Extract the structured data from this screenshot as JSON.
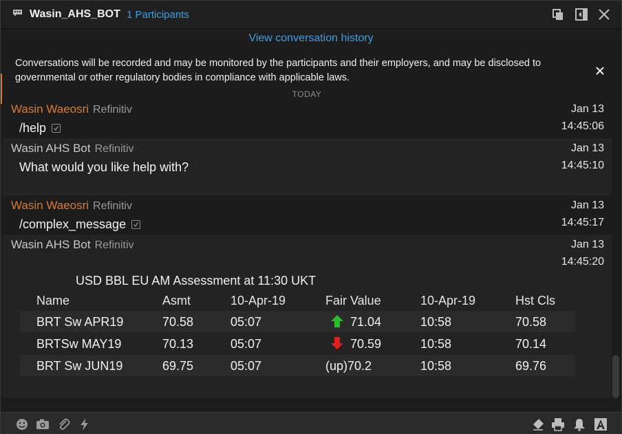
{
  "window": {
    "title": "Wasin_AHS_BOT",
    "participants": "1 Participants"
  },
  "history_link": "View conversation history",
  "notice": {
    "text": "Conversations will be recorded and may be monitored by the participants and their employers, and may be disclosed to governmental or other regulatory bodies in compliance with applicable laws."
  },
  "day_separator": "TODAY",
  "messages": [
    {
      "sender": "Wasin Waeosri",
      "org": "Refinitiv",
      "date": "Jan 13",
      "time": "14:45:06",
      "text": "/help"
    },
    {
      "sender": "Wasin AHS Bot",
      "org": "Refinitiv",
      "date": "Jan 13",
      "time": "14:45:10",
      "text": "What would you like help with?"
    },
    {
      "sender": "Wasin Waeosri",
      "org": "Refinitiv",
      "date": "Jan 13",
      "time": "14:45:17",
      "text": "/complex_message"
    },
    {
      "sender": "Wasin AHS Bot",
      "org": "Refinitiv",
      "date": "Jan 13",
      "time": "14:45:20",
      "text": ""
    }
  ],
  "table": {
    "title": "USD BBL EU AM Assessment at 11:30 UKT",
    "headers": [
      "Name",
      "Asmt",
      "10-Apr-19",
      "Fair Value",
      "10-Apr-19",
      "Hst Cls"
    ],
    "rows": [
      {
        "name": "BRT Sw APR19",
        "asmt": "70.58",
        "time1": "05:07",
        "fair_value": "71.04",
        "direction": "up-arrow-icon",
        "time2": "10:58",
        "hst_cls": "70.58"
      },
      {
        "name": "BRTSw MAY19",
        "asmt": "70.13",
        "time1": "05:07",
        "fair_value": "70.59",
        "direction": "down-arrow-icon",
        "time2": "10:58",
        "hst_cls": "70.14"
      },
      {
        "name": "BRT Sw JUN19",
        "asmt": "69.75",
        "time1": "05:07",
        "fair_value": "(up)70.2",
        "direction": "",
        "time2": "10:58",
        "hst_cls": "69.76"
      }
    ]
  },
  "colors": {
    "accent_link": "#3aa0e8",
    "user_name": "#dc7b2a",
    "up": "#2db82d",
    "down": "#e0201c"
  },
  "toolbar_icons": [
    "emoji-icon",
    "camera-icon",
    "attachment-icon",
    "lightning-icon",
    "eraser-icon",
    "print-icon",
    "bell-icon",
    "font-icon"
  ]
}
